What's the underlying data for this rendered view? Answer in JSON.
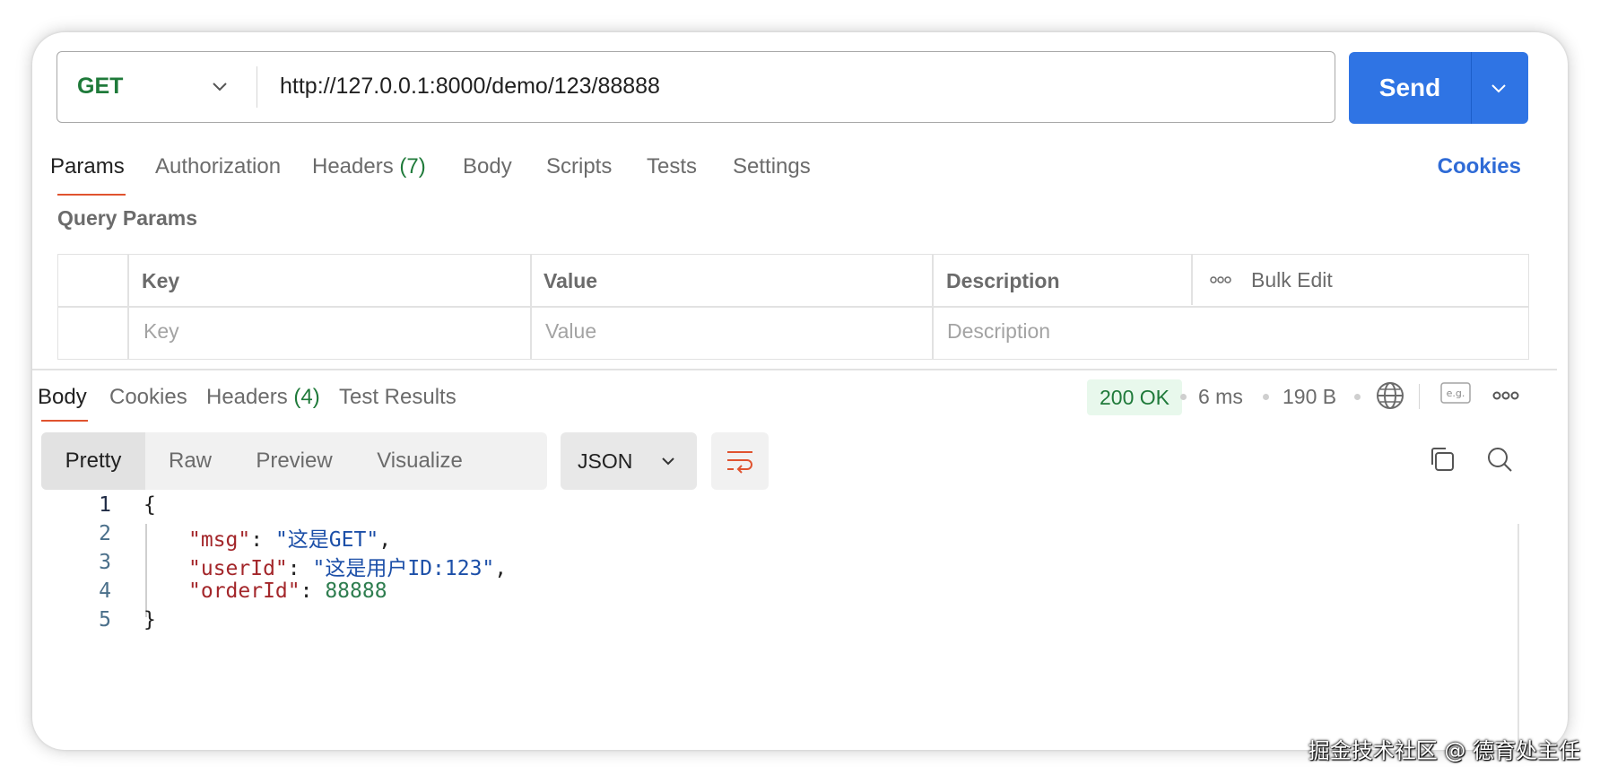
{
  "request": {
    "method": "GET",
    "url": "http://127.0.0.1:8000/demo/123/88888",
    "send_label": "Send"
  },
  "request_tabs": {
    "params": "Params",
    "authorization": "Authorization",
    "headers": "Headers",
    "headers_count": "(7)",
    "body": "Body",
    "scripts": "Scripts",
    "tests": "Tests",
    "settings": "Settings",
    "cookies": "Cookies"
  },
  "query_params": {
    "title": "Query Params",
    "headers": {
      "key": "Key",
      "value": "Value",
      "description": "Description",
      "bulk_edit": "Bulk Edit"
    },
    "placeholders": {
      "key": "Key",
      "value": "Value",
      "description": "Description"
    }
  },
  "response_tabs": {
    "body": "Body",
    "cookies": "Cookies",
    "headers": "Headers",
    "headers_count": "(4)",
    "test_results": "Test Results"
  },
  "response_meta": {
    "status": "200 OK",
    "time": "6 ms",
    "size": "190 B"
  },
  "view_modes": [
    "Pretty",
    "Raw",
    "Preview",
    "Visualize"
  ],
  "format": "JSON",
  "code": {
    "line_numbers": [
      "1",
      "2",
      "3",
      "4",
      "5"
    ],
    "open_brace": "{",
    "close_brace": "}",
    "entries": [
      {
        "key": "\"msg\"",
        "value": "\"这是GET\"",
        "trail": ","
      },
      {
        "key": "\"userId\"",
        "value": "\"这是用户ID:123\"",
        "trail": ","
      },
      {
        "key": "\"orderId\"",
        "value": "88888",
        "trail": ""
      }
    ]
  },
  "watermark": "掘金技术社区 @ 德育处主任",
  "colors": {
    "accent": "#2f74e4",
    "active_tab": "#e0532f",
    "method": "#1f7a3a",
    "status_bg": "#e8f8ec"
  }
}
